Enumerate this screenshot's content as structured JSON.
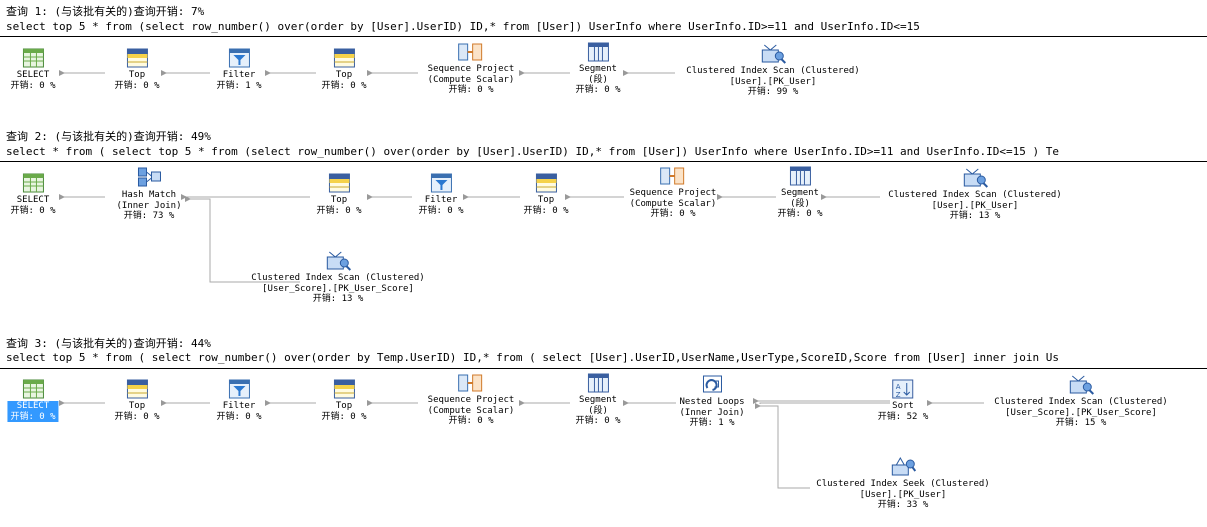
{
  "queries": [
    {
      "header": "查询 1: (与该批有关的)查询开销: 7%",
      "sql": "select top 5 * from (select row_number() over(order by [User].UserID) ID,* from [User]) UserInfo where UserInfo.ID>=11 and UserInfo.ID<=15",
      "nodes": [
        {
          "name": "SELECT",
          "line2": "",
          "cost": "开销: 0 %",
          "icon": "select"
        },
        {
          "name": "Top",
          "line2": "",
          "cost": "开销: 0 %",
          "icon": "top"
        },
        {
          "name": "Filter",
          "line2": "",
          "cost": "开销: 1 %",
          "icon": "filter"
        },
        {
          "name": "Top",
          "line2": "",
          "cost": "开销: 0 %",
          "icon": "top"
        },
        {
          "name": "Sequence Project",
          "line2": "(Compute Scalar)",
          "cost": "开销: 0 %",
          "icon": "seqproj"
        },
        {
          "name": "Segment",
          "line2": "(段)",
          "cost": "开销: 0 %",
          "icon": "segment"
        },
        {
          "name": "Clustered Index Scan (Clustered)",
          "line2": "[User].[PK_User]",
          "cost": "开销: 99 %",
          "icon": "scan"
        }
      ]
    },
    {
      "header": "查询 2: (与该批有关的)查询开销: 49%",
      "sql": "select * from ( select top 5 * from (select row_number() over(order by [User].UserID) ID,* from [User]) UserInfo where UserInfo.ID>=11 and UserInfo.ID<=15 ) Te",
      "nodes": [
        {
          "name": "SELECT",
          "line2": "",
          "cost": "开销: 0 %",
          "icon": "select"
        },
        {
          "name": "Hash Match",
          "line2": "(Inner Join)",
          "cost": "开销: 73 %",
          "icon": "hash"
        },
        {
          "name": "Top",
          "line2": "",
          "cost": "开销: 0 %",
          "icon": "top"
        },
        {
          "name": "Filter",
          "line2": "",
          "cost": "开销: 0 %",
          "icon": "filter"
        },
        {
          "name": "Top",
          "line2": "",
          "cost": "开销: 0 %",
          "icon": "top"
        },
        {
          "name": "Sequence Project",
          "line2": "(Compute Scalar)",
          "cost": "开销: 0 %",
          "icon": "seqproj"
        },
        {
          "name": "Segment",
          "line2": "(段)",
          "cost": "开销: 0 %",
          "icon": "segment"
        },
        {
          "name": "Clustered Index Scan (Clustered)",
          "line2": "[User].[PK_User]",
          "cost": "开销: 13 %",
          "icon": "scan"
        },
        {
          "name": "Clustered Index Scan (Clustered)",
          "line2": "[User_Score].[PK_User_Score]",
          "cost": "开销: 13 %",
          "icon": "scan"
        }
      ]
    },
    {
      "header": "查询 3: (与该批有关的)查询开销: 44%",
      "sql": "select top 5 * from ( select row_number() over(order by Temp.UserID) ID,* from ( select [User].UserID,UserName,UserType,ScoreID,Score from [User] inner join Us",
      "nodes": [
        {
          "name": "SELECT",
          "line2": "",
          "cost": "开销: 0 %",
          "icon": "select"
        },
        {
          "name": "Top",
          "line2": "",
          "cost": "开销: 0 %",
          "icon": "top"
        },
        {
          "name": "Filter",
          "line2": "",
          "cost": "开销: 0 %",
          "icon": "filter"
        },
        {
          "name": "Top",
          "line2": "",
          "cost": "开销: 0 %",
          "icon": "top"
        },
        {
          "name": "Sequence Project",
          "line2": "(Compute Scalar)",
          "cost": "开销: 0 %",
          "icon": "seqproj"
        },
        {
          "name": "Segment",
          "line2": "(段)",
          "cost": "开销: 0 %",
          "icon": "segment"
        },
        {
          "name": "Nested Loops",
          "line2": "(Inner Join)",
          "cost": "开销: 1 %",
          "icon": "nested"
        },
        {
          "name": "Sort",
          "line2": "",
          "cost": "开销: 52 %",
          "icon": "sort"
        },
        {
          "name": "Clustered Index Scan (Clustered)",
          "line2": "[User_Score].[PK_User_Score]",
          "cost": "开销: 15 %",
          "icon": "scan"
        },
        {
          "name": "Clustered Index Seek (Clustered)",
          "line2": "[User].[PK_User]",
          "cost": "开销: 33 %",
          "icon": "seek"
        }
      ]
    }
  ],
  "colors": {
    "selected": "#3399ff",
    "arrow": "#999999",
    "line": "#000000"
  }
}
